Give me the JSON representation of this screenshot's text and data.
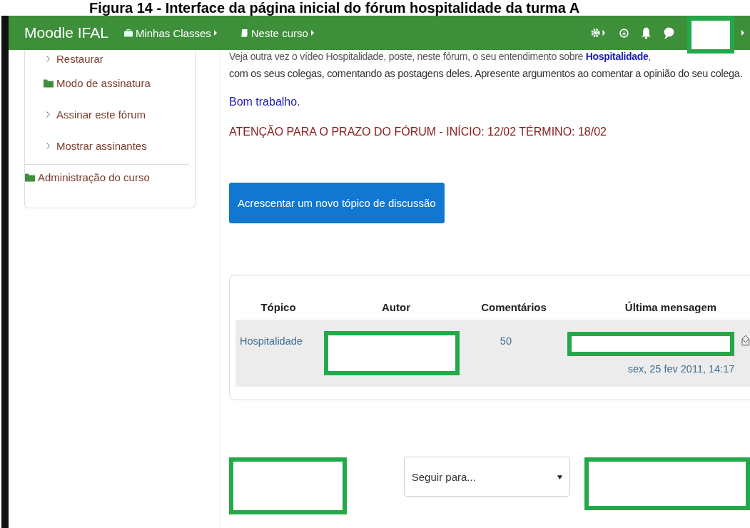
{
  "caption": "Figura 14 - Interface da página inicial do fórum hospitalidade da turma A",
  "navbar": {
    "brand": "Moodle IFAL",
    "menus": [
      {
        "label": "Minhas Classes",
        "kind": "briefcase"
      },
      {
        "label": "Neste curso",
        "kind": "book"
      }
    ]
  },
  "sidebar": {
    "items": [
      {
        "label": "Restaurar",
        "kind": "link"
      },
      {
        "label": "Modo de assinatura",
        "kind": "folder"
      },
      {
        "label": "Assinar este fórum",
        "kind": "link"
      },
      {
        "label": "Mostrar assinantes",
        "kind": "link"
      },
      {
        "label": "Administração do curso",
        "kind": "folder",
        "divider_before": true
      }
    ]
  },
  "intro": {
    "lines": [
      "Veja outra vez o vídeo Hospitalidade, poste, neste fórum, o seu entendimento sobre **Hospitalidade**,",
      "com os seus colegas, comentando as postagens deles. Apresente argumentos ao comentar a opinião do seu colega."
    ],
    "closing": "Bom trabalho",
    "closing_end": ".",
    "deadline": "ATENÇÃO PARA O PRAZO DO FÓRUM - INÍCIO: 12/02 TÉRMINO: 18/02"
  },
  "add_button": "Acrescentar um novo tópico de discussão",
  "table": {
    "columns": [
      "Tópico",
      "Autor",
      "Comentários",
      "Última mensagem"
    ],
    "rows": [
      {
        "topic": "Hospitalidade",
        "comments": "50",
        "last_date": "sex, 25 fev 2011, 14:17"
      }
    ]
  },
  "jump": {
    "placeholder": "Seguir para..."
  }
}
